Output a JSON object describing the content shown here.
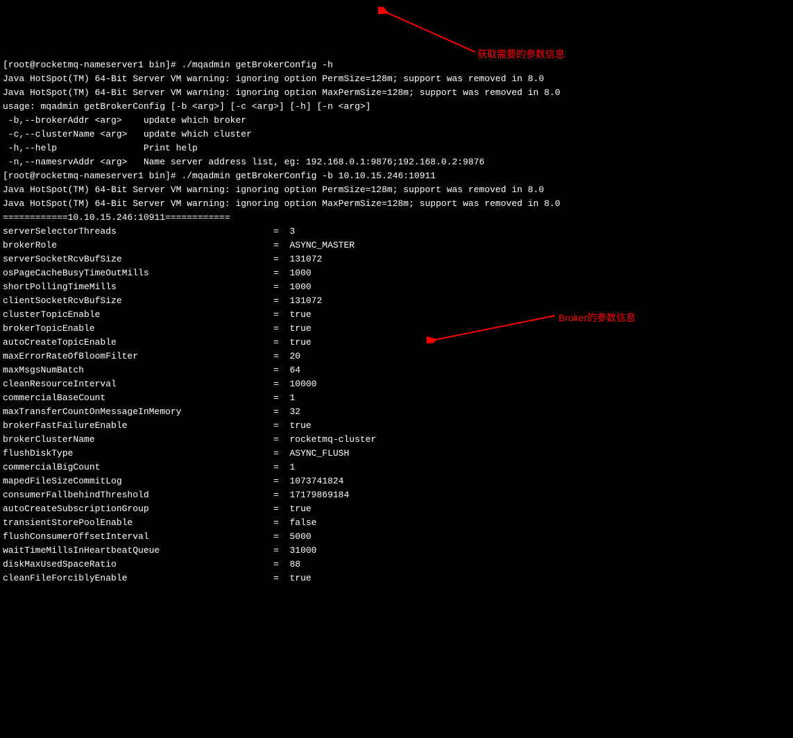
{
  "lines": [
    "[root@rocketmq-nameserver1 bin]# ./mqadmin getBrokerConfig -h",
    "Java HotSpot(TM) 64-Bit Server VM warning: ignoring option PermSize=128m; support was removed in 8.0",
    "Java HotSpot(TM) 64-Bit Server VM warning: ignoring option MaxPermSize=128m; support was removed in 8.0",
    "usage: mqadmin getBrokerConfig [-b <arg>] [-c <arg>] [-h] [-n <arg>]",
    " -b,--brokerAddr <arg>    update which broker",
    " -c,--clusterName <arg>   update which cluster",
    " -h,--help                Print help",
    " -n,--namesrvAddr <arg>   Name server address list, eg: 192.168.0.1:9876;192.168.0.2:9876",
    "[root@rocketmq-nameserver1 bin]# ./mqadmin getBrokerConfig -b 10.10.15.246:10911",
    "Java HotSpot(TM) 64-Bit Server VM warning: ignoring option PermSize=128m; support was removed in 8.0",
    "Java HotSpot(TM) 64-Bit Server VM warning: ignoring option MaxPermSize=128m; support was removed in 8.0",
    "============10.10.15.246:10911============",
    "serverSelectorThreads                             =  3",
    "brokerRole                                        =  ASYNC_MASTER",
    "serverSocketRcvBufSize                            =  131072",
    "osPageCacheBusyTimeOutMills                       =  1000",
    "shortPollingTimeMills                             =  1000",
    "clientSocketRcvBufSize                            =  131072",
    "clusterTopicEnable                                =  true",
    "brokerTopicEnable                                 =  true",
    "autoCreateTopicEnable                             =  true",
    "maxErrorRateOfBloomFilter                         =  20",
    "maxMsgsNumBatch                                   =  64",
    "cleanResourceInterval                             =  10000",
    "commercialBaseCount                               =  1",
    "maxTransferCountOnMessageInMemory                 =  32",
    "brokerFastFailureEnable                           =  true",
    "brokerClusterName                                 =  rocketmq-cluster",
    "flushDiskType                                     =  ASYNC_FLUSH",
    "commercialBigCount                                =  1",
    "mapedFileSizeCommitLog                            =  1073741824",
    "consumerFallbehindThreshold                       =  17179869184",
    "autoCreateSubscriptionGroup                       =  true",
    "transientStorePoolEnable                          =  false",
    "flushConsumerOffsetInterval                       =  5000",
    "waitTimeMillsInHeartbeatQueue                     =  31000",
    "diskMaxUsedSpaceRatio                             =  88",
    "cleanFileForciblyEnable                           =  true"
  ],
  "annotations": {
    "a1": "获取需要的参数信息",
    "a2": "Broker的参数信息"
  }
}
